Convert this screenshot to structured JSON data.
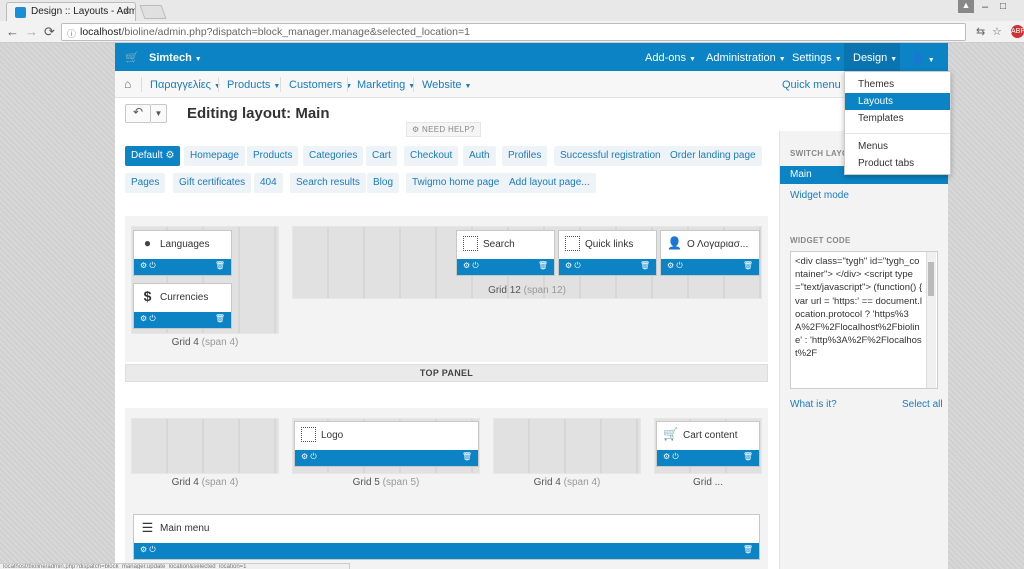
{
  "browser": {
    "tab_title": "Design :: Layouts - Admi",
    "tab_close": "×",
    "url_host": "localhost",
    "url_path": "/bioline/admin.php?dispatch=block_manager.manage&selected_location=1",
    "user_icon": "person-icon",
    "min": "‒",
    "max": "□",
    "back": "←",
    "forward": "→",
    "reload": "⟳",
    "translate": "⇆",
    "star": "☆",
    "ext_label": "ABP"
  },
  "topbar": {
    "home_icon": "cart-icon",
    "store": "Simtech",
    "items": [
      "Add-ons",
      "Administration",
      "Settings",
      "Design"
    ],
    "user_icon": "user-icon"
  },
  "subnav": {
    "items": [
      "Παραγγελίες",
      "Products",
      "Customers",
      "Marketing",
      "Website"
    ],
    "quick_menu": "Quick menu"
  },
  "title": {
    "text": "Editing layout: Main",
    "need_help": "NEED HELP?"
  },
  "location_tabs": {
    "row1": [
      "Default",
      "Homepage",
      "Products",
      "Categories",
      "Cart",
      "Checkout",
      "Auth",
      "Profiles",
      "Successful registration",
      "Order landing page"
    ],
    "row2": [
      "Pages",
      "Gift certificates",
      "404",
      "Search results",
      "Blog",
      "Twigmo home page",
      "Add layout page..."
    ]
  },
  "top_panel": {
    "label": "TOP PANEL",
    "grid_a": {
      "name": "Grid 4",
      "span": "(span 4)"
    },
    "grid_b": {
      "name": "Grid 12",
      "span": "(span 12)"
    },
    "blocks": [
      "Languages",
      "Currencies",
      "Search",
      "Quick links",
      "Ο Λογαριασ..."
    ]
  },
  "header_panel": {
    "grids": [
      {
        "name": "Grid 4",
        "span": "(span 4)"
      },
      {
        "name": "Grid 5",
        "span": "(span 5)"
      },
      {
        "name": "Grid 4",
        "span": "(span 4)"
      },
      {
        "name": "Grid ...",
        "span": ""
      }
    ],
    "blocks": [
      "Logo",
      "Cart content",
      "Main menu"
    ]
  },
  "sidebar": {
    "switch_heading": "SWITCH LAYOUT",
    "active_layout": "Main",
    "widget_mode": "Widget mode",
    "widget_heading": "WIDGET CODE",
    "code": "<div class=\"tygh\" id=\"tygh_container\"> </div> <script type=\"text/javascript\"> (function() { var url = 'https:' == document.location.protocol ? 'https%3A%2F%2Flocalhost%2Fbioline' : 'http%3A%2F%2Flocalhost%2F",
    "what_is_it": "What is it?",
    "select_all": "Select all"
  },
  "design_menu": {
    "items": [
      "Themes",
      "Layouts",
      "Templates",
      "Menus",
      "Product tabs"
    ],
    "active": "Layouts"
  },
  "status_url": "localhost/bioline/admin.php?dispatch=block_manager.update_location&selected_location=1"
}
